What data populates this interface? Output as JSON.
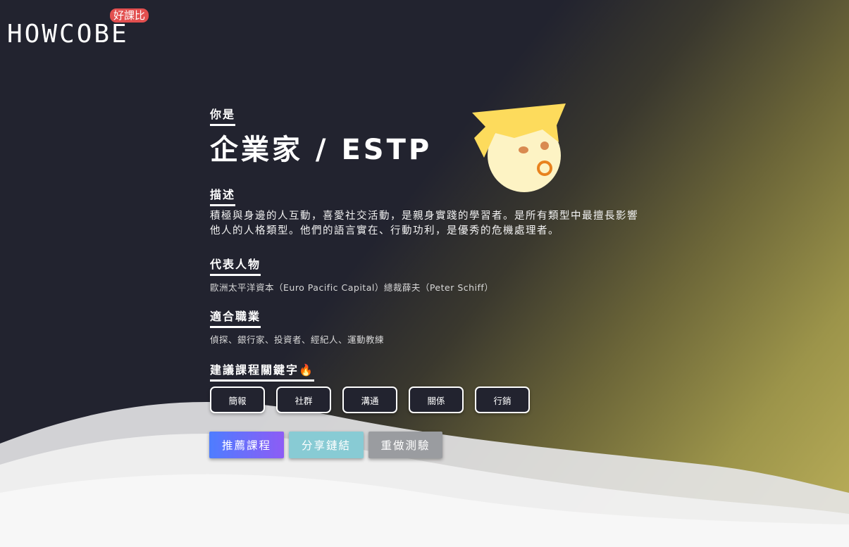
{
  "logo": {
    "wordmark": "HOWCOBE",
    "badge": "好課比"
  },
  "result": {
    "intro_label": "你是",
    "title": "企業家 / ESTP"
  },
  "description": {
    "label": "描述",
    "text": "積極與身邊的人互動，喜愛社交活動，是親身實踐的學習者。是所有類型中最擅長影響他人的人格類型。他們的語言實在、行動功利，是優秀的危機處理者。"
  },
  "representative": {
    "label": "代表人物",
    "text": "歐洲太平洋資本（Euro Pacific Capital）總裁薛夫（Peter Schiff）"
  },
  "careers": {
    "label": "適合職業",
    "text": "偵探、銀行家、投資者、經紀人、運動教練"
  },
  "keywords": {
    "label": "建議課程關鍵字🔥",
    "items": [
      "簡報",
      "社群",
      "溝通",
      "關係",
      "行銷"
    ]
  },
  "actions": {
    "recommend": "推薦課程",
    "share": "分享鏈結",
    "retake": "重做測驗"
  },
  "colors": {
    "background": "#22232f",
    "accent_gold": "#bcb05a",
    "badge_red": "#e24f4f",
    "avatar_hair": "#fddb5c",
    "avatar_face": "#fdf3c4",
    "avatar_mouth": "#e8821e"
  }
}
